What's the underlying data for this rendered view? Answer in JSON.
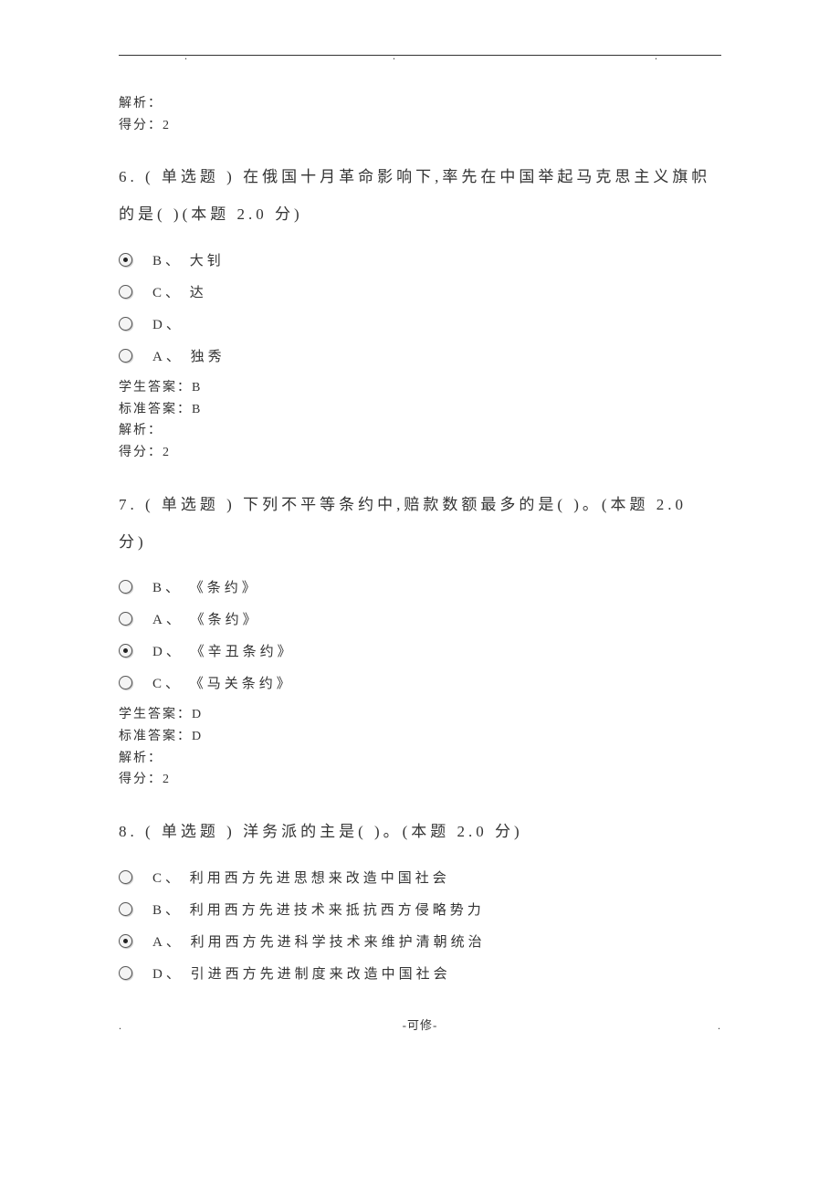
{
  "prev_tail": {
    "analysis_label": "解析：",
    "score_label": "得分：2"
  },
  "q6": {
    "stem": "6. ( 单选题 ) 在俄国十月革命影响下,率先在中国举起马克思主义旗帜的是( )(本题 2.0 分)",
    "options": {
      "b": "B、 大钊",
      "c": "C、 达",
      "d": "D、",
      "a": "A、 独秀"
    },
    "selected": "b",
    "student_answer": "学生答案：B",
    "standard_answer": "标准答案：B",
    "analysis_label": "解析：",
    "score_label": "得分：2"
  },
  "q7": {
    "stem": "7. ( 单选题 ) 下列不平等条约中,赔款数额最多的是( )。(本题 2.0 分)",
    "options": {
      "b": "B、 《条约》",
      "a": "A、 《条约》",
      "d": "D、 《辛丑条约》",
      "c": "C、 《马关条约》"
    },
    "selected": "d",
    "student_answer": "学生答案：D",
    "standard_answer": "标准答案：D",
    "analysis_label": "解析：",
    "score_label": "得分：2"
  },
  "q8": {
    "stem": "8. ( 单选题 ) 洋务派的主是( )。(本题 2.0 分)",
    "options": {
      "c": "C、 利用西方先进思想来改造中国社会",
      "b": "B、 利用西方先进技术来抵抗西方侵略势力",
      "a": "A、 利用西方先进科学技术来维护清朝统治",
      "d": "D、 引进西方先进制度来改造中国社会"
    },
    "selected": "a"
  },
  "footer": "-可修-"
}
